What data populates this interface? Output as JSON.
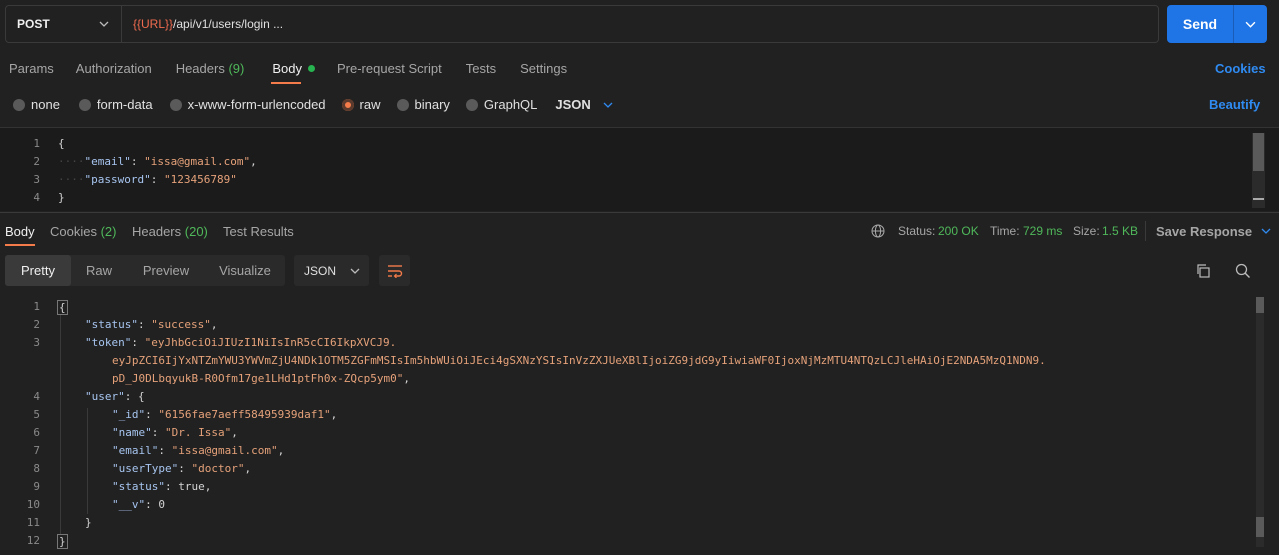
{
  "request": {
    "method": "POST",
    "url_var": "{{URL}}",
    "url_path": "/api/v1/users/login ...",
    "send_label": "Send"
  },
  "req_tabs": [
    {
      "label": "Params"
    },
    {
      "label": "Authorization"
    },
    {
      "label": "Headers",
      "count": "(9)"
    },
    {
      "label": "Body"
    },
    {
      "label": "Pre-request Script"
    },
    {
      "label": "Tests"
    },
    {
      "label": "Settings"
    }
  ],
  "cookies_link": "Cookies",
  "body_types": [
    "none",
    "form-data",
    "x-www-form-urlencoded",
    "raw",
    "binary",
    "GraphQL"
  ],
  "body_selected": "raw",
  "body_format": "JSON",
  "beautify_label": "Beautify",
  "req_body": {
    "line_numbers": [
      "1",
      "2",
      "3",
      "4"
    ],
    "open": "{",
    "email_key": "\"email\"",
    "email_val": "\"issa@gmail.com\"",
    "password_key": "\"password\"",
    "password_val": "\"123456789\"",
    "close": "}"
  },
  "resp_tabs": [
    {
      "label": "Body"
    },
    {
      "label": "Cookies",
      "count": "(2)"
    },
    {
      "label": "Headers",
      "count": "(20)"
    },
    {
      "label": "Test Results"
    }
  ],
  "resp_meta": {
    "status_label": "Status:",
    "status_value": "200 OK",
    "time_label": "Time:",
    "time_value": "729 ms",
    "size_label": "Size:",
    "size_value": "1.5 KB",
    "save_label": "Save Response"
  },
  "view_modes": [
    "Pretty",
    "Raw",
    "Preview",
    "Visualize"
  ],
  "view_active": "Pretty",
  "resp_format": "JSON",
  "resp_body": {
    "line_numbers": [
      "1",
      "2",
      "3",
      "",
      "",
      "4",
      "5",
      "6",
      "7",
      "8",
      "9",
      "10",
      "11",
      "12"
    ],
    "status_key": "\"status\"",
    "status_val": "\"success\"",
    "token_key": "\"token\"",
    "token_line1": "\"eyJhbGciOiJIUzI1NiIsInR5cCI6IkpXVCJ9.",
    "token_line2": "eyJpZCI6IjYxNTZmYWU3YWVmZjU4NDk1OTM5ZGFmMSIsIm5hbWUiOiJEci4gSXNzYSIsInVzZXJUeXBlIjoiZG9jdG9yIiwiaWF0IjoxNjMzMTU4NTQzLCJleHAiOjE2NDA5MzQ1NDN9.",
    "token_line3": "pD_J0DLbqyukB-R0Ofm17ge1LHd1ptFh0x-ZQcp5ym0\"",
    "user_key": "\"user\"",
    "id_key": "\"_id\"",
    "id_val": "\"6156fae7aeff58495939daf1\"",
    "name_key": "\"name\"",
    "name_val": "\"Dr. Issa\"",
    "email_key": "\"email\"",
    "email_val": "\"issa@gmail.com\"",
    "usertype_key": "\"userType\"",
    "usertype_val": "\"doctor\"",
    "ustatus_key": "\"status\"",
    "ustatus_val": "true",
    "v_key": "\"__v\"",
    "v_val": "0"
  },
  "colors": {
    "accent": "#f47b4a",
    "send": "#1f74e6",
    "link": "#2f8bf2",
    "ok": "#4fb85a",
    "string": "#e6a27a",
    "key": "#a7c5f0"
  }
}
